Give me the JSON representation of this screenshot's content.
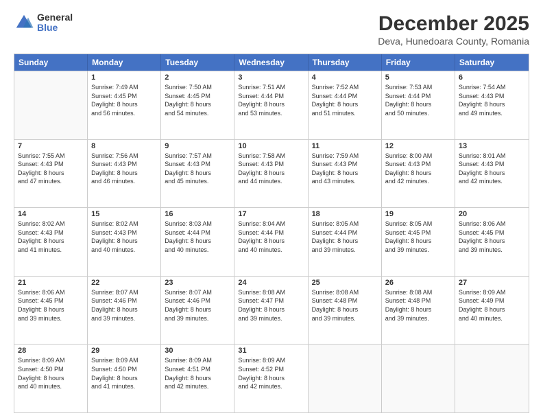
{
  "header": {
    "logo_general": "General",
    "logo_blue": "Blue",
    "main_title": "December 2025",
    "subtitle": "Deva, Hunedoara County, Romania"
  },
  "days": [
    "Sunday",
    "Monday",
    "Tuesday",
    "Wednesday",
    "Thursday",
    "Friday",
    "Saturday"
  ],
  "weeks": [
    [
      {
        "day": "",
        "lines": []
      },
      {
        "day": "1",
        "lines": [
          "Sunrise: 7:49 AM",
          "Sunset: 4:45 PM",
          "Daylight: 8 hours",
          "and 56 minutes."
        ]
      },
      {
        "day": "2",
        "lines": [
          "Sunrise: 7:50 AM",
          "Sunset: 4:45 PM",
          "Daylight: 8 hours",
          "and 54 minutes."
        ]
      },
      {
        "day": "3",
        "lines": [
          "Sunrise: 7:51 AM",
          "Sunset: 4:44 PM",
          "Daylight: 8 hours",
          "and 53 minutes."
        ]
      },
      {
        "day": "4",
        "lines": [
          "Sunrise: 7:52 AM",
          "Sunset: 4:44 PM",
          "Daylight: 8 hours",
          "and 51 minutes."
        ]
      },
      {
        "day": "5",
        "lines": [
          "Sunrise: 7:53 AM",
          "Sunset: 4:44 PM",
          "Daylight: 8 hours",
          "and 50 minutes."
        ]
      },
      {
        "day": "6",
        "lines": [
          "Sunrise: 7:54 AM",
          "Sunset: 4:43 PM",
          "Daylight: 8 hours",
          "and 49 minutes."
        ]
      }
    ],
    [
      {
        "day": "7",
        "lines": [
          "Sunrise: 7:55 AM",
          "Sunset: 4:43 PM",
          "Daylight: 8 hours",
          "and 47 minutes."
        ]
      },
      {
        "day": "8",
        "lines": [
          "Sunrise: 7:56 AM",
          "Sunset: 4:43 PM",
          "Daylight: 8 hours",
          "and 46 minutes."
        ]
      },
      {
        "day": "9",
        "lines": [
          "Sunrise: 7:57 AM",
          "Sunset: 4:43 PM",
          "Daylight: 8 hours",
          "and 45 minutes."
        ]
      },
      {
        "day": "10",
        "lines": [
          "Sunrise: 7:58 AM",
          "Sunset: 4:43 PM",
          "Daylight: 8 hours",
          "and 44 minutes."
        ]
      },
      {
        "day": "11",
        "lines": [
          "Sunrise: 7:59 AM",
          "Sunset: 4:43 PM",
          "Daylight: 8 hours",
          "and 43 minutes."
        ]
      },
      {
        "day": "12",
        "lines": [
          "Sunrise: 8:00 AM",
          "Sunset: 4:43 PM",
          "Daylight: 8 hours",
          "and 42 minutes."
        ]
      },
      {
        "day": "13",
        "lines": [
          "Sunrise: 8:01 AM",
          "Sunset: 4:43 PM",
          "Daylight: 8 hours",
          "and 42 minutes."
        ]
      }
    ],
    [
      {
        "day": "14",
        "lines": [
          "Sunrise: 8:02 AM",
          "Sunset: 4:43 PM",
          "Daylight: 8 hours",
          "and 41 minutes."
        ]
      },
      {
        "day": "15",
        "lines": [
          "Sunrise: 8:02 AM",
          "Sunset: 4:43 PM",
          "Daylight: 8 hours",
          "and 40 minutes."
        ]
      },
      {
        "day": "16",
        "lines": [
          "Sunrise: 8:03 AM",
          "Sunset: 4:44 PM",
          "Daylight: 8 hours",
          "and 40 minutes."
        ]
      },
      {
        "day": "17",
        "lines": [
          "Sunrise: 8:04 AM",
          "Sunset: 4:44 PM",
          "Daylight: 8 hours",
          "and 40 minutes."
        ]
      },
      {
        "day": "18",
        "lines": [
          "Sunrise: 8:05 AM",
          "Sunset: 4:44 PM",
          "Daylight: 8 hours",
          "and 39 minutes."
        ]
      },
      {
        "day": "19",
        "lines": [
          "Sunrise: 8:05 AM",
          "Sunset: 4:45 PM",
          "Daylight: 8 hours",
          "and 39 minutes."
        ]
      },
      {
        "day": "20",
        "lines": [
          "Sunrise: 8:06 AM",
          "Sunset: 4:45 PM",
          "Daylight: 8 hours",
          "and 39 minutes."
        ]
      }
    ],
    [
      {
        "day": "21",
        "lines": [
          "Sunrise: 8:06 AM",
          "Sunset: 4:45 PM",
          "Daylight: 8 hours",
          "and 39 minutes."
        ]
      },
      {
        "day": "22",
        "lines": [
          "Sunrise: 8:07 AM",
          "Sunset: 4:46 PM",
          "Daylight: 8 hours",
          "and 39 minutes."
        ]
      },
      {
        "day": "23",
        "lines": [
          "Sunrise: 8:07 AM",
          "Sunset: 4:46 PM",
          "Daylight: 8 hours",
          "and 39 minutes."
        ]
      },
      {
        "day": "24",
        "lines": [
          "Sunrise: 8:08 AM",
          "Sunset: 4:47 PM",
          "Daylight: 8 hours",
          "and 39 minutes."
        ]
      },
      {
        "day": "25",
        "lines": [
          "Sunrise: 8:08 AM",
          "Sunset: 4:48 PM",
          "Daylight: 8 hours",
          "and 39 minutes."
        ]
      },
      {
        "day": "26",
        "lines": [
          "Sunrise: 8:08 AM",
          "Sunset: 4:48 PM",
          "Daylight: 8 hours",
          "and 39 minutes."
        ]
      },
      {
        "day": "27",
        "lines": [
          "Sunrise: 8:09 AM",
          "Sunset: 4:49 PM",
          "Daylight: 8 hours",
          "and 40 minutes."
        ]
      }
    ],
    [
      {
        "day": "28",
        "lines": [
          "Sunrise: 8:09 AM",
          "Sunset: 4:50 PM",
          "Daylight: 8 hours",
          "and 40 minutes."
        ]
      },
      {
        "day": "29",
        "lines": [
          "Sunrise: 8:09 AM",
          "Sunset: 4:50 PM",
          "Daylight: 8 hours",
          "and 41 minutes."
        ]
      },
      {
        "day": "30",
        "lines": [
          "Sunrise: 8:09 AM",
          "Sunset: 4:51 PM",
          "Daylight: 8 hours",
          "and 42 minutes."
        ]
      },
      {
        "day": "31",
        "lines": [
          "Sunrise: 8:09 AM",
          "Sunset: 4:52 PM",
          "Daylight: 8 hours",
          "and 42 minutes."
        ]
      },
      {
        "day": "",
        "lines": []
      },
      {
        "day": "",
        "lines": []
      },
      {
        "day": "",
        "lines": []
      }
    ]
  ]
}
